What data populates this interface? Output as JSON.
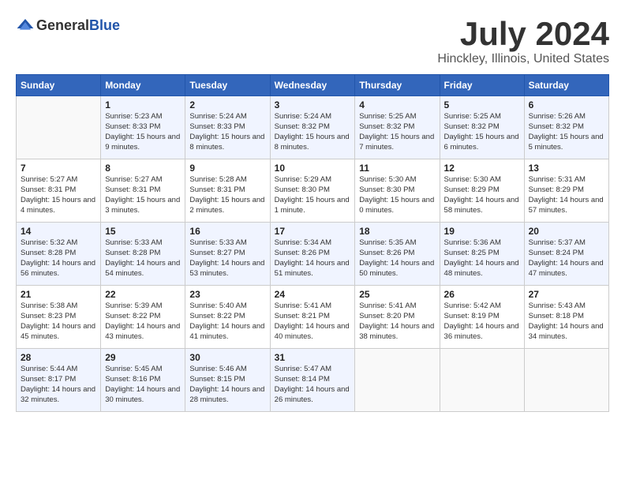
{
  "logo": {
    "general": "General",
    "blue": "Blue"
  },
  "title": {
    "month": "July 2024",
    "location": "Hinckley, Illinois, United States"
  },
  "headers": [
    "Sunday",
    "Monday",
    "Tuesday",
    "Wednesday",
    "Thursday",
    "Friday",
    "Saturday"
  ],
  "weeks": [
    [
      {
        "day": "",
        "sunrise": "",
        "sunset": "",
        "daylight": ""
      },
      {
        "day": "1",
        "sunrise": "Sunrise: 5:23 AM",
        "sunset": "Sunset: 8:33 PM",
        "daylight": "Daylight: 15 hours and 9 minutes."
      },
      {
        "day": "2",
        "sunrise": "Sunrise: 5:24 AM",
        "sunset": "Sunset: 8:33 PM",
        "daylight": "Daylight: 15 hours and 8 minutes."
      },
      {
        "day": "3",
        "sunrise": "Sunrise: 5:24 AM",
        "sunset": "Sunset: 8:32 PM",
        "daylight": "Daylight: 15 hours and 8 minutes."
      },
      {
        "day": "4",
        "sunrise": "Sunrise: 5:25 AM",
        "sunset": "Sunset: 8:32 PM",
        "daylight": "Daylight: 15 hours and 7 minutes."
      },
      {
        "day": "5",
        "sunrise": "Sunrise: 5:25 AM",
        "sunset": "Sunset: 8:32 PM",
        "daylight": "Daylight: 15 hours and 6 minutes."
      },
      {
        "day": "6",
        "sunrise": "Sunrise: 5:26 AM",
        "sunset": "Sunset: 8:32 PM",
        "daylight": "Daylight: 15 hours and 5 minutes."
      }
    ],
    [
      {
        "day": "7",
        "sunrise": "Sunrise: 5:27 AM",
        "sunset": "Sunset: 8:31 PM",
        "daylight": "Daylight: 15 hours and 4 minutes."
      },
      {
        "day": "8",
        "sunrise": "Sunrise: 5:27 AM",
        "sunset": "Sunset: 8:31 PM",
        "daylight": "Daylight: 15 hours and 3 minutes."
      },
      {
        "day": "9",
        "sunrise": "Sunrise: 5:28 AM",
        "sunset": "Sunset: 8:31 PM",
        "daylight": "Daylight: 15 hours and 2 minutes."
      },
      {
        "day": "10",
        "sunrise": "Sunrise: 5:29 AM",
        "sunset": "Sunset: 8:30 PM",
        "daylight": "Daylight: 15 hours and 1 minute."
      },
      {
        "day": "11",
        "sunrise": "Sunrise: 5:30 AM",
        "sunset": "Sunset: 8:30 PM",
        "daylight": "Daylight: 15 hours and 0 minutes."
      },
      {
        "day": "12",
        "sunrise": "Sunrise: 5:30 AM",
        "sunset": "Sunset: 8:29 PM",
        "daylight": "Daylight: 14 hours and 58 minutes."
      },
      {
        "day": "13",
        "sunrise": "Sunrise: 5:31 AM",
        "sunset": "Sunset: 8:29 PM",
        "daylight": "Daylight: 14 hours and 57 minutes."
      }
    ],
    [
      {
        "day": "14",
        "sunrise": "Sunrise: 5:32 AM",
        "sunset": "Sunset: 8:28 PM",
        "daylight": "Daylight: 14 hours and 56 minutes."
      },
      {
        "day": "15",
        "sunrise": "Sunrise: 5:33 AM",
        "sunset": "Sunset: 8:28 PM",
        "daylight": "Daylight: 14 hours and 54 minutes."
      },
      {
        "day": "16",
        "sunrise": "Sunrise: 5:33 AM",
        "sunset": "Sunset: 8:27 PM",
        "daylight": "Daylight: 14 hours and 53 minutes."
      },
      {
        "day": "17",
        "sunrise": "Sunrise: 5:34 AM",
        "sunset": "Sunset: 8:26 PM",
        "daylight": "Daylight: 14 hours and 51 minutes."
      },
      {
        "day": "18",
        "sunrise": "Sunrise: 5:35 AM",
        "sunset": "Sunset: 8:26 PM",
        "daylight": "Daylight: 14 hours and 50 minutes."
      },
      {
        "day": "19",
        "sunrise": "Sunrise: 5:36 AM",
        "sunset": "Sunset: 8:25 PM",
        "daylight": "Daylight: 14 hours and 48 minutes."
      },
      {
        "day": "20",
        "sunrise": "Sunrise: 5:37 AM",
        "sunset": "Sunset: 8:24 PM",
        "daylight": "Daylight: 14 hours and 47 minutes."
      }
    ],
    [
      {
        "day": "21",
        "sunrise": "Sunrise: 5:38 AM",
        "sunset": "Sunset: 8:23 PM",
        "daylight": "Daylight: 14 hours and 45 minutes."
      },
      {
        "day": "22",
        "sunrise": "Sunrise: 5:39 AM",
        "sunset": "Sunset: 8:22 PM",
        "daylight": "Daylight: 14 hours and 43 minutes."
      },
      {
        "day": "23",
        "sunrise": "Sunrise: 5:40 AM",
        "sunset": "Sunset: 8:22 PM",
        "daylight": "Daylight: 14 hours and 41 minutes."
      },
      {
        "day": "24",
        "sunrise": "Sunrise: 5:41 AM",
        "sunset": "Sunset: 8:21 PM",
        "daylight": "Daylight: 14 hours and 40 minutes."
      },
      {
        "day": "25",
        "sunrise": "Sunrise: 5:41 AM",
        "sunset": "Sunset: 8:20 PM",
        "daylight": "Daylight: 14 hours and 38 minutes."
      },
      {
        "day": "26",
        "sunrise": "Sunrise: 5:42 AM",
        "sunset": "Sunset: 8:19 PM",
        "daylight": "Daylight: 14 hours and 36 minutes."
      },
      {
        "day": "27",
        "sunrise": "Sunrise: 5:43 AM",
        "sunset": "Sunset: 8:18 PM",
        "daylight": "Daylight: 14 hours and 34 minutes."
      }
    ],
    [
      {
        "day": "28",
        "sunrise": "Sunrise: 5:44 AM",
        "sunset": "Sunset: 8:17 PM",
        "daylight": "Daylight: 14 hours and 32 minutes."
      },
      {
        "day": "29",
        "sunrise": "Sunrise: 5:45 AM",
        "sunset": "Sunset: 8:16 PM",
        "daylight": "Daylight: 14 hours and 30 minutes."
      },
      {
        "day": "30",
        "sunrise": "Sunrise: 5:46 AM",
        "sunset": "Sunset: 8:15 PM",
        "daylight": "Daylight: 14 hours and 28 minutes."
      },
      {
        "day": "31",
        "sunrise": "Sunrise: 5:47 AM",
        "sunset": "Sunset: 8:14 PM",
        "daylight": "Daylight: 14 hours and 26 minutes."
      },
      {
        "day": "",
        "sunrise": "",
        "sunset": "",
        "daylight": ""
      },
      {
        "day": "",
        "sunrise": "",
        "sunset": "",
        "daylight": ""
      },
      {
        "day": "",
        "sunrise": "",
        "sunset": "",
        "daylight": ""
      }
    ]
  ]
}
